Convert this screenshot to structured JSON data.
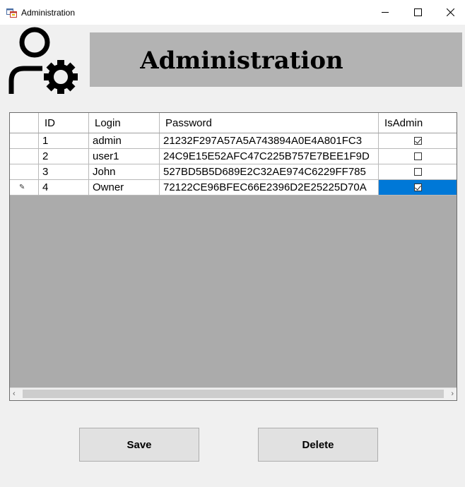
{
  "window": {
    "title": "Administration",
    "icons": {
      "app": "form-icon",
      "minimize": "minimize-icon",
      "maximize": "maximize-icon",
      "close": "close-icon"
    }
  },
  "header": {
    "logo_icon": "user-settings-icon",
    "title": "Administration"
  },
  "grid": {
    "columns": [
      "ID",
      "Login",
      "Password",
      "IsAdmin"
    ],
    "rows": [
      {
        "id": "1",
        "login": "admin",
        "password": "21232F297A57A5A743894A0E4A801FC3",
        "is_admin": true
      },
      {
        "id": "2",
        "login": "user1",
        "password": "24C9E15E52AFC47C225B757E7BEE1F9D",
        "is_admin": false
      },
      {
        "id": "3",
        "login": "John",
        "password": "527BD5B5D689E2C32AE974C6229FF785",
        "is_admin": false
      },
      {
        "id": "4",
        "login": "Owner",
        "password": "72122CE96BFEC66E2396D2E25225D70A",
        "is_admin": true
      }
    ],
    "selected_row": 4,
    "selection_color": "#0078d7"
  },
  "actions": {
    "save_label": "Save",
    "delete_label": "Delete"
  }
}
